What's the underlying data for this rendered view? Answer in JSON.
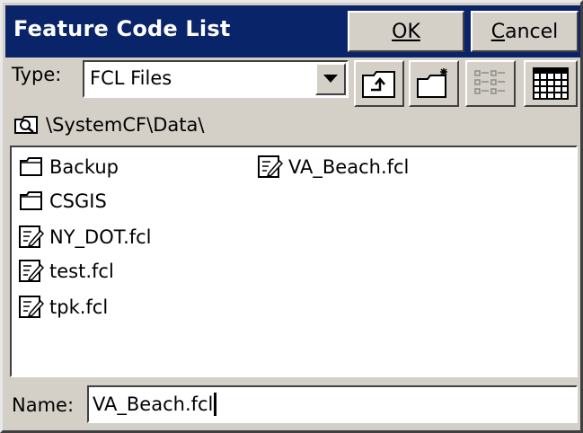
{
  "dialog": {
    "title": "Feature Code List",
    "ok_label": "OK",
    "cancel_label": "Cancel"
  },
  "type_row": {
    "label": "Type:",
    "selected": "FCL Files"
  },
  "toolbar": {
    "icons": [
      "up-folder-icon",
      "new-folder-icon",
      "list-view-icon",
      "details-view-icon"
    ]
  },
  "path": {
    "value": "\\SystemCF\\Data\\"
  },
  "files": [
    {
      "name": "Backup",
      "kind": "folder"
    },
    {
      "name": "CSGIS",
      "kind": "folder"
    },
    {
      "name": "NY_DOT.fcl",
      "kind": "file"
    },
    {
      "name": "test.fcl",
      "kind": "file"
    },
    {
      "name": "tpk.fcl",
      "kind": "file"
    },
    {
      "name": "VA_Beach.fcl",
      "kind": "file"
    }
  ],
  "name_row": {
    "label": "Name:",
    "value": "VA_Beach.fcl"
  },
  "colors": {
    "titlebar": "#0a246a",
    "face": "#d4d0c8"
  }
}
